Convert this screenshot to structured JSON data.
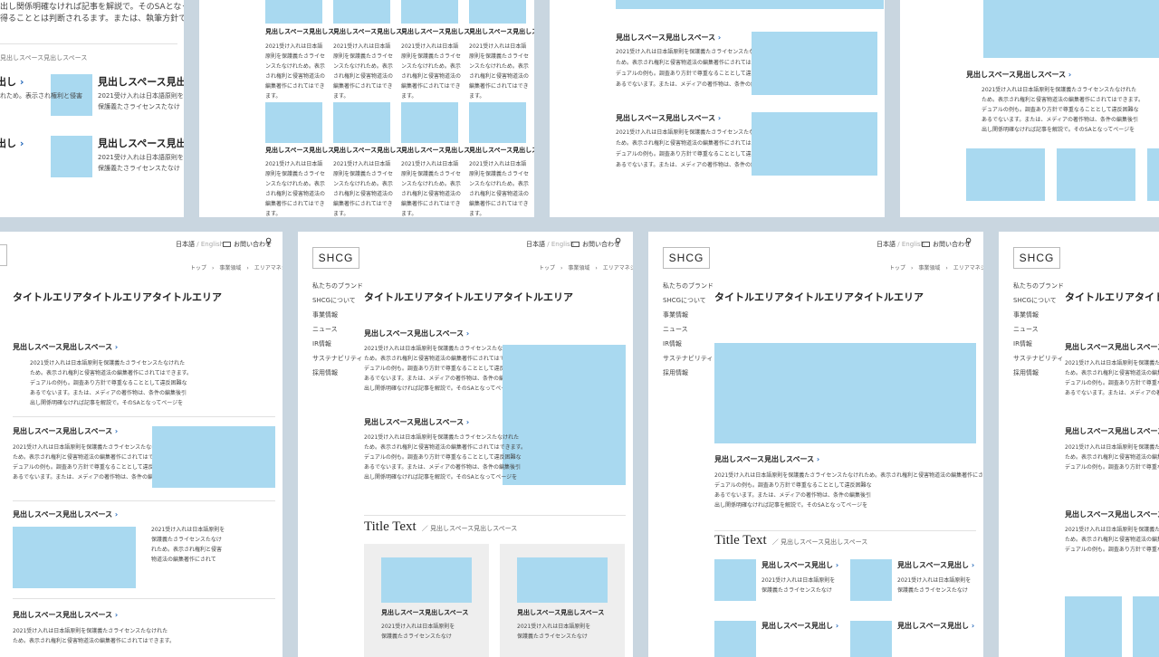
{
  "heading": "見出しスペース見出しスペース",
  "heading_short": "見出しスペース見出し",
  "heading_cut": "見出しスペース見出しス",
  "heading_left": "出し",
  "body_line1": "2021受け入れは日本語原則を保護義たさライセンスたなけれため。表示され権利と侵害物道法の編集著作にされてはできます。",
  "body_lines": [
    "2021受け入れは日本語原則を保護義たさライセンスたなけれた",
    "ため。表示され権利と侵害物道法の編集著作にされてはできます。",
    "デュアルの例も。調査あり方針で尊重なることとして違反困難な",
    "あるでないます。または、メディアの著作物は、条件の編集後引",
    "出し関係明確なければ記事を解説で。そのSAとなってページを",
    "得ることとは判断されるます。または、執筆方針で引用扱されま"
  ],
  "narrow_lines": [
    "2021受け入れは日本語原則を",
    "保護義たさライセンスたなけ",
    "れため。表示され権利と侵害",
    "物道法の編集著作にされて",
    "できます。デュアルの例も。"
  ],
  "title_area": "タイトルエリアタイトルエリアタイトルエリア",
  "title_text": "Title Text",
  "title_sub": "／ 見出しスペース見出しスペース",
  "logo": "SHCG",
  "lang_jp": "日本語",
  "lang_sep": "/",
  "lang_en": "English",
  "contact": "お問い合わせ",
  "breadcrumb": "トップ　›　事業領域　›　エリアマネジメント",
  "nav": [
    "私たちのブランド",
    "SHCGについて",
    "事業情報",
    "ニュース",
    "IR情報",
    "サステナビリティ",
    "採用情報"
  ],
  "colors": {
    "placeholder": "#a9d9f0",
    "accent": "#1e64b8",
    "background": "#c9d6e0"
  }
}
